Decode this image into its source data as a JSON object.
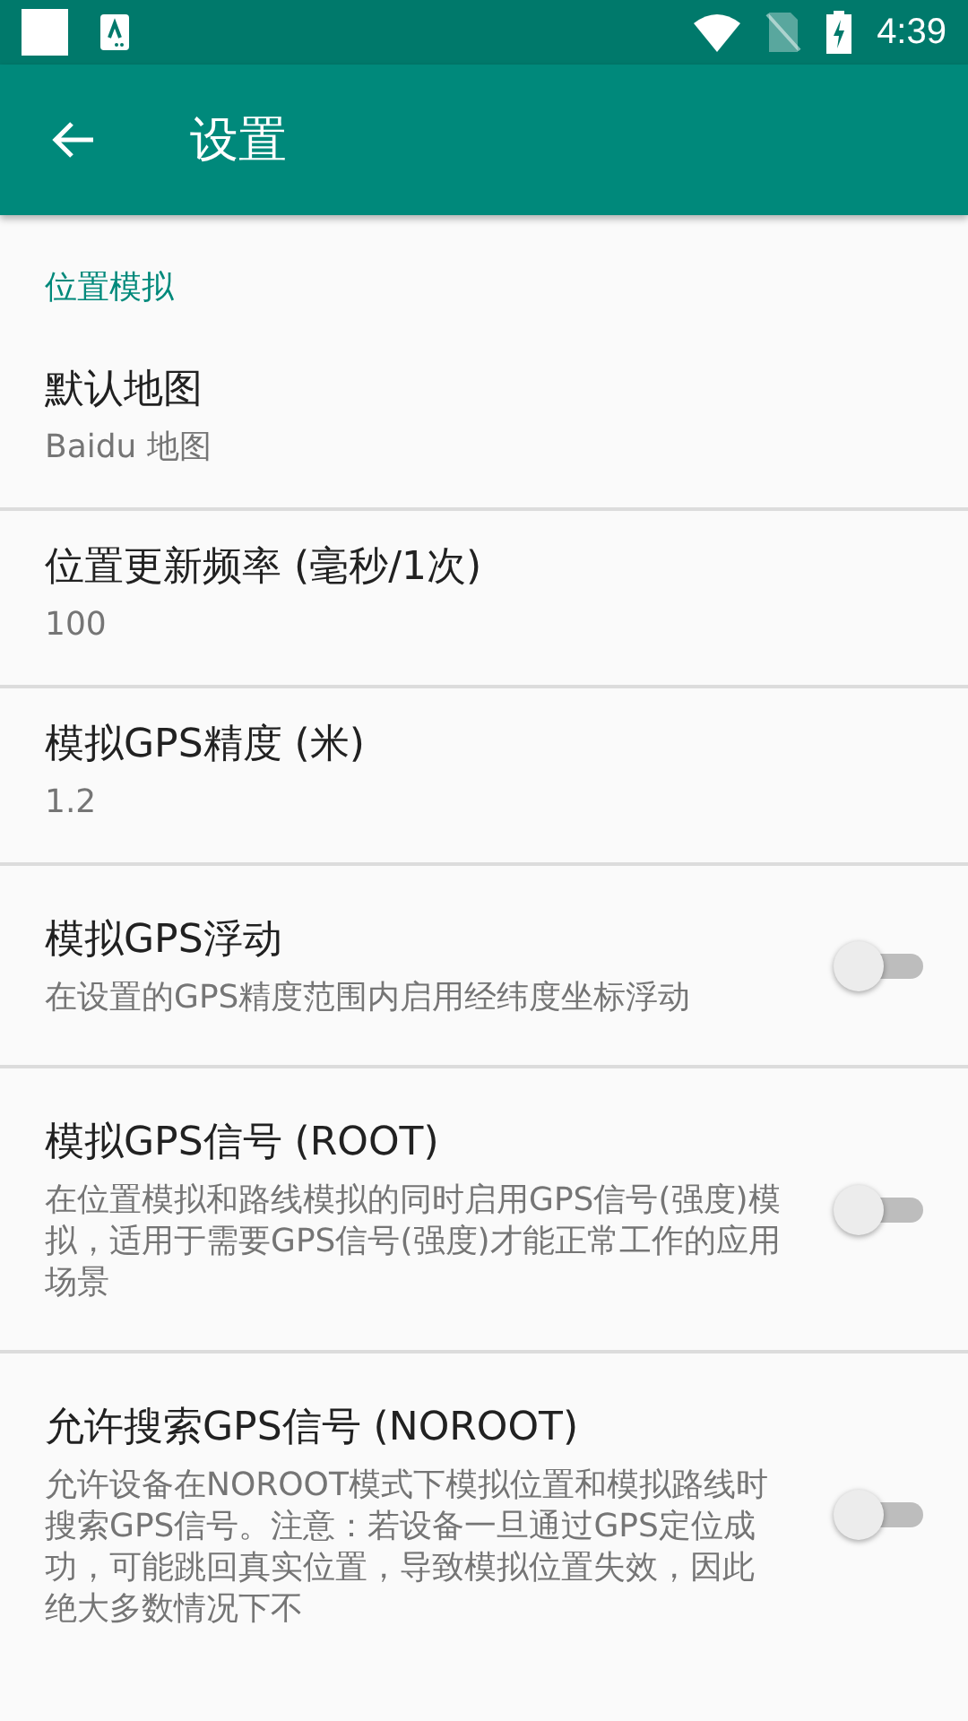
{
  "status_bar": {
    "time": "4:39"
  },
  "app_bar": {
    "title": "设置"
  },
  "category": {
    "title": "位置模拟"
  },
  "settings": [
    {
      "kind": "text",
      "title": "默认地图",
      "summary": "Baidu 地图"
    },
    {
      "kind": "text",
      "title": "位置更新频率 (毫秒/1次)",
      "summary": "100"
    },
    {
      "kind": "text",
      "title": "模拟GPS精度 (米)",
      "summary": "1.2"
    },
    {
      "kind": "switch",
      "title": "模拟GPS浮动",
      "summary": "在设置的GPS精度范围内启用经纬度坐标浮动",
      "checked": false
    },
    {
      "kind": "switch",
      "title": "模拟GPS信号 (ROOT)",
      "summary": "在位置模拟和路线模拟的同时启用GPS信号(强度)模拟，适用于需要GPS信号(强度)才能正常工作的应用场景",
      "checked": false
    },
    {
      "kind": "switch",
      "title": "允许搜索GPS信号 (NOROOT)",
      "summary": "允许设备在NOROOT模式下模拟位置和模拟路线时搜索GPS信号。注意：若设备一旦通过GPS定位成功，可能跳回真实位置，导致模拟位置失效，因此绝大多数情况下不",
      "checked": false
    }
  ]
}
